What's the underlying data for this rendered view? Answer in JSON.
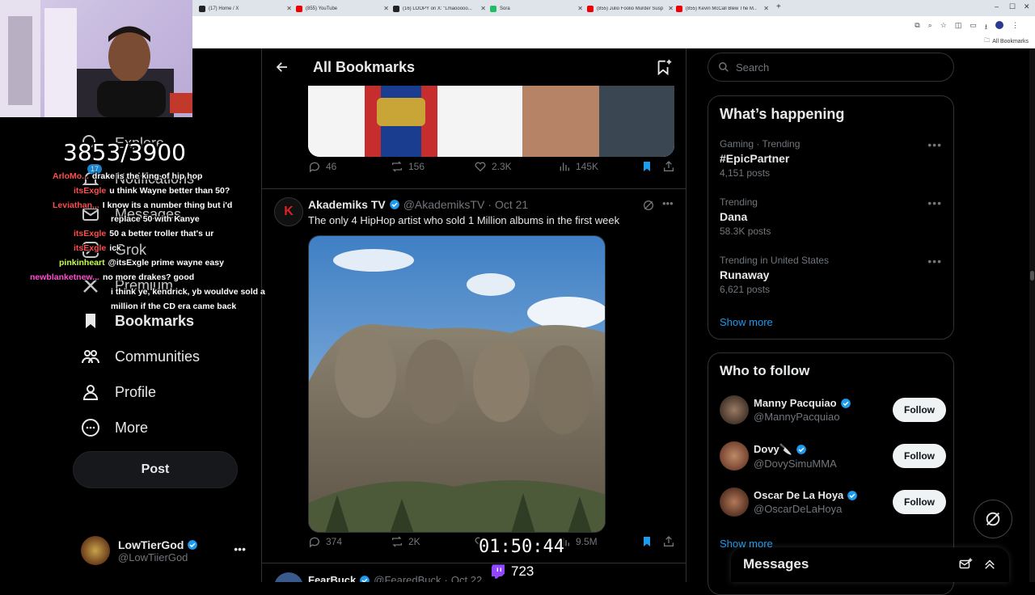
{
  "browser": {
    "tabs": [
      {
        "title": "(17) Home / X",
        "color": "#222"
      },
      {
        "title": "(855) YouTube",
        "color": "#e00"
      },
      {
        "title": "(16) LOOPY on X: \"Lmaooooo...",
        "color": "#222"
      },
      {
        "title": "Sora",
        "color": "#2b6"
      },
      {
        "title": "(855) Julio Foolio Murder Susp...",
        "color": "#e00"
      },
      {
        "title": "(855) Kevin McCall Blew The M...",
        "color": "#e00"
      }
    ],
    "new_tab": "+",
    "bookmarks_label": "All Bookmarks"
  },
  "overlay": {
    "counter": "3853/3900",
    "timer": "01:50:44",
    "twitch_viewers": "723",
    "chat": [
      {
        "user": "ArloMo...",
        "user_color": "#ff4d4d",
        "msg": "drake is the king of hip hop"
      },
      {
        "user": "itsExgle",
        "user_color": "#ff4d4d",
        "msg": "u think Wayne better than 50?"
      },
      {
        "user": "Leviathan...",
        "user_color": "#ff4d4d",
        "msg": "I know its a number thing but i'd"
      },
      {
        "user": "",
        "user_color": "#fff",
        "msg": "replace 50 with Kanye"
      },
      {
        "user": "itsExgle",
        "user_color": "#ff4d4d",
        "msg": "50 a better troller that's ur"
      },
      {
        "user": "itsExgle",
        "user_color": "#ff4d4d",
        "msg": "ick"
      },
      {
        "user": "pinkinheart",
        "user_color": "#c7ff4d",
        "msg": "@itsExgle prime wayne easy"
      },
      {
        "user": "newblanketnew...",
        "user_color": "#ff4dd2",
        "msg": "no more drakes? good"
      },
      {
        "user": "",
        "user_color": "#fff",
        "msg": "i think ye, kendrick, yb wouldve sold a"
      },
      {
        "user": "",
        "user_color": "#fff",
        "msg": "million if the CD era came back"
      }
    ]
  },
  "nav": {
    "explore": "Explore",
    "notifications": "Notifications",
    "notif_badge": "17",
    "messages": "Messages",
    "grok": "Grok",
    "premium": "Premium",
    "bookmarks": "Bookmarks",
    "communities": "Communities",
    "profile": "Profile",
    "more": "More",
    "post": "Post",
    "account_name": "LowTierGod",
    "account_handle": "@LowTiierGod"
  },
  "main": {
    "title": "All Bookmarks",
    "prev_tweet_stats": {
      "replies": "46",
      "retweets": "156",
      "likes": "2.3K",
      "views": "145K"
    },
    "tweet": {
      "author": "Akademiks TV",
      "handle": "@AkademiksTV",
      "date": "Oct 21",
      "text": "The only 4 HipHop artist who sold 1 Million albums in the first week",
      "stats": {
        "replies": "374",
        "retweets": "2K",
        "likes": "",
        "views": "9.5M"
      }
    },
    "next_tweet": {
      "author": "FearBuck",
      "handle": "@FearedBuck",
      "date": "Oct 22"
    }
  },
  "sidebar": {
    "search_placeholder": "Search",
    "happening_title": "What’s happening",
    "trends": [
      {
        "meta": "Gaming · Trending",
        "name": "#EpicPartner",
        "count": "4,151 posts"
      },
      {
        "meta": "Trending",
        "name": "Dana",
        "count": "58.3K posts"
      },
      {
        "meta": "Trending in United States",
        "name": "Runaway",
        "count": "6,621 posts"
      }
    ],
    "show_more": "Show more",
    "wtf_title": "Who to follow",
    "who_to_follow": [
      {
        "name": "Manny Pacquiao",
        "handle": "@MannyPacquiao",
        "follow": "Follow"
      },
      {
        "name": "Dovy🔪",
        "handle": "@DovySimuMMA",
        "follow": "Follow"
      },
      {
        "name": "Oscar De La Hoya",
        "handle": "@OscarDeLaHoya",
        "follow": "Follow"
      }
    ],
    "show_more_2": "Show more",
    "messages_title": "Messages"
  },
  "colors": {
    "accent": "#1d9bf0",
    "bg": "#000000",
    "border": "#2f3336",
    "muted": "#71767b"
  }
}
